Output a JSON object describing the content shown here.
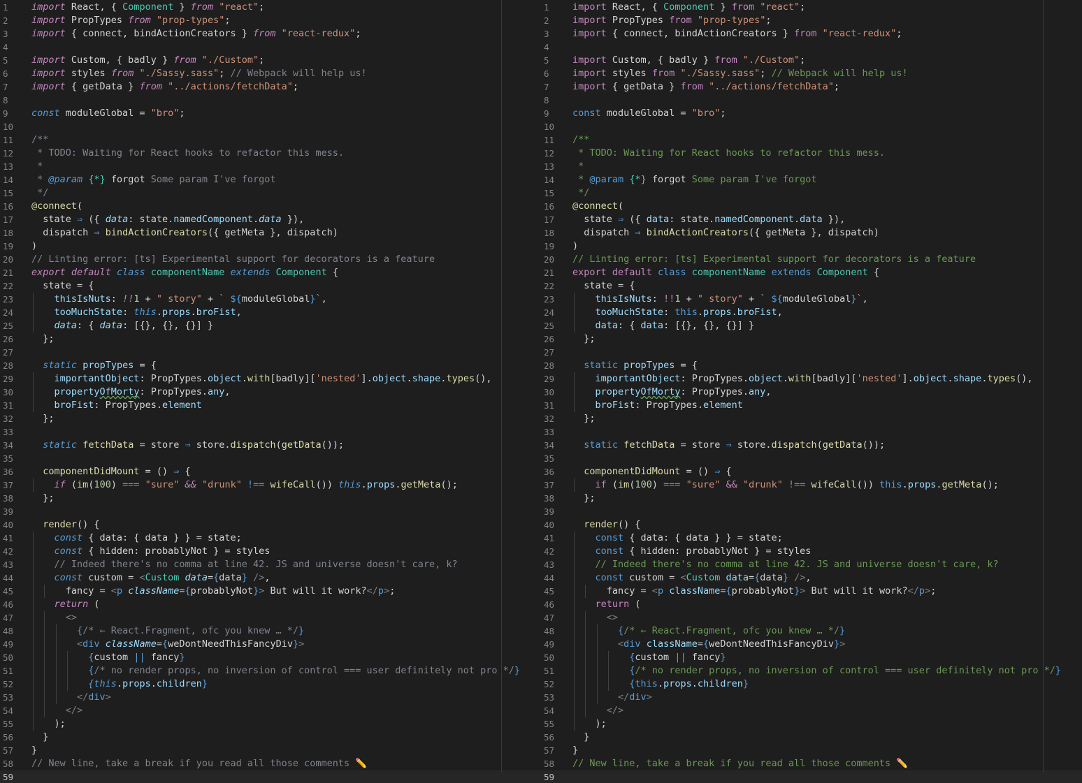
{
  "colors": {
    "background": "#1e1e1e",
    "line_number": "#858585",
    "keyword": "#c586c0",
    "storage": "#569cd6",
    "string": "#ce9178",
    "comment": "#6a9955",
    "comment_left": "#7f848e",
    "property": "#9cdcfe",
    "function": "#dcdcaa",
    "class": "#4ec9b0",
    "number": "#b5cea8",
    "plain": "#d4d4d4"
  },
  "editor": {
    "cursor_line": 59,
    "panes": [
      {
        "name": "left",
        "italic_keywords": true,
        "comment_color": "#7f848e"
      },
      {
        "name": "right",
        "italic_keywords": false,
        "comment_color": "#6a9955"
      }
    ]
  },
  "code_lines": [
    [
      [
        "k",
        "import"
      ],
      [
        "p",
        " React, { "
      ],
      [
        "t",
        "Component"
      ],
      [
        "p",
        " } "
      ],
      [
        "k",
        "from"
      ],
      [
        "s",
        " \"react\""
      ],
      [
        "p",
        ";"
      ]
    ],
    [
      [
        "k",
        "import"
      ],
      [
        "p",
        " PropTypes "
      ],
      [
        "k",
        "from"
      ],
      [
        "s",
        " \"prop-types\""
      ],
      [
        "p",
        ";"
      ]
    ],
    [
      [
        "k",
        "import"
      ],
      [
        "p",
        " { connect, bindActionCreators } "
      ],
      [
        "k",
        "from"
      ],
      [
        "s",
        " \"react-redux\""
      ],
      [
        "p",
        ";"
      ]
    ],
    [],
    [
      [
        "k",
        "import"
      ],
      [
        "p",
        " Custom, { badly } "
      ],
      [
        "k",
        "from"
      ],
      [
        "s",
        " \"./Custom\""
      ],
      [
        "p",
        ";"
      ]
    ],
    [
      [
        "k",
        "import"
      ],
      [
        "p",
        " styles "
      ],
      [
        "k",
        "from"
      ],
      [
        "s",
        " \"./Sassy.sass\""
      ],
      [
        "p",
        "; "
      ],
      [
        "c",
        "// Webpack will help us!"
      ]
    ],
    [
      [
        "k",
        "import"
      ],
      [
        "p",
        " { getData } "
      ],
      [
        "k",
        "from"
      ],
      [
        "s",
        " \"../actions/fetchData\""
      ],
      [
        "p",
        ";"
      ]
    ],
    [],
    [
      [
        "b",
        "const"
      ],
      [
        "p",
        " moduleGlobal = "
      ],
      [
        "s",
        "\"bro\""
      ],
      [
        "p",
        ";"
      ]
    ],
    [],
    [
      [
        "c",
        "/**"
      ]
    ],
    [
      [
        "c",
        " * TODO: Waiting for React hooks to refactor this mess."
      ]
    ],
    [
      [
        "c",
        " *"
      ]
    ],
    [
      [
        "c",
        " * "
      ],
      [
        "b",
        "@param"
      ],
      [
        "p",
        " "
      ],
      [
        "t",
        "{*}"
      ],
      [
        "p",
        " forgot"
      ],
      [
        "c",
        " Some param I've forgot"
      ]
    ],
    [
      [
        "c",
        " */"
      ]
    ],
    [
      [
        "f",
        "@connect"
      ],
      [
        "p",
        "("
      ]
    ],
    [
      [
        "p",
        "  state "
      ],
      [
        "b",
        "⇒"
      ],
      [
        "p",
        " ({ "
      ],
      [
        "v",
        "data"
      ],
      [
        "p",
        ": state."
      ],
      [
        "v",
        "namedComponent"
      ],
      [
        "p",
        "."
      ],
      [
        "v",
        "data"
      ],
      [
        "p",
        " }),"
      ]
    ],
    [
      [
        "p",
        "  dispatch "
      ],
      [
        "b",
        "⇒"
      ],
      [
        "p",
        " "
      ],
      [
        "f",
        "bindActionCreators"
      ],
      [
        "p",
        "({ getMeta }, dispatch)"
      ]
    ],
    [
      [
        "p",
        ")"
      ]
    ],
    [
      [
        "c",
        "// Linting error: [ts] Experimental support for decorators is a feature"
      ]
    ],
    [
      [
        "k",
        "export"
      ],
      [
        "p",
        " "
      ],
      [
        "k",
        "default"
      ],
      [
        "p",
        " "
      ],
      [
        "b",
        "class"
      ],
      [
        "p",
        " "
      ],
      [
        "t",
        "componentName"
      ],
      [
        "p",
        " "
      ],
      [
        "b",
        "extends"
      ],
      [
        "p",
        " "
      ],
      [
        "t",
        "Component"
      ],
      [
        "p",
        " {"
      ]
    ],
    [
      [
        "p",
        "  state = {"
      ]
    ],
    [
      [
        "p",
        "    "
      ],
      [
        "v",
        "thisIsNuts"
      ],
      [
        "p",
        ": "
      ],
      [
        "k",
        "!!"
      ],
      [
        "n",
        "1"
      ],
      [
        "p",
        " + "
      ],
      [
        "s",
        "\" story\""
      ],
      [
        "p",
        " + "
      ],
      [
        "s",
        "` "
      ],
      [
        "b",
        "${"
      ],
      [
        "p",
        "moduleGlobal"
      ],
      [
        "b",
        "}"
      ],
      [
        "s",
        "`"
      ],
      [
        "p",
        ","
      ]
    ],
    [
      [
        "p",
        "    "
      ],
      [
        "v",
        "tooMuchState"
      ],
      [
        "p",
        ": "
      ],
      [
        "b",
        "this"
      ],
      [
        "p",
        "."
      ],
      [
        "v",
        "props"
      ],
      [
        "p",
        "."
      ],
      [
        "v",
        "broFist"
      ],
      [
        "p",
        ","
      ]
    ],
    [
      [
        "p",
        "    "
      ],
      [
        "v",
        "data"
      ],
      [
        "p",
        ": { "
      ],
      [
        "v",
        "data"
      ],
      [
        "p",
        ": [{}, {}, {}] }"
      ]
    ],
    [
      [
        "p",
        "  };"
      ]
    ],
    [],
    [
      [
        "p",
        "  "
      ],
      [
        "b",
        "static"
      ],
      [
        "p",
        " "
      ],
      [
        "v",
        "propTypes"
      ],
      [
        "p",
        " = {"
      ]
    ],
    [
      [
        "p",
        "    "
      ],
      [
        "v",
        "importantObject"
      ],
      [
        "p",
        ": PropTypes."
      ],
      [
        "v",
        "object"
      ],
      [
        "p",
        "."
      ],
      [
        "f",
        "with"
      ],
      [
        "p",
        "[badly]["
      ],
      [
        "s",
        "'nested'"
      ],
      [
        "p",
        "]."
      ],
      [
        "v",
        "object"
      ],
      [
        "p",
        "."
      ],
      [
        "v",
        "shape"
      ],
      [
        "p",
        "."
      ],
      [
        "f",
        "types"
      ],
      [
        "p",
        "(),"
      ]
    ],
    [
      [
        "p",
        "    "
      ],
      [
        "v",
        "property"
      ],
      [
        "w",
        "OfMorty"
      ],
      [
        "p",
        ": PropTypes."
      ],
      [
        "v",
        "any"
      ],
      [
        "p",
        ","
      ]
    ],
    [
      [
        "p",
        "    "
      ],
      [
        "v",
        "broFist"
      ],
      [
        "p",
        ": PropTypes."
      ],
      [
        "v",
        "element"
      ]
    ],
    [
      [
        "p",
        "  };"
      ]
    ],
    [],
    [
      [
        "p",
        "  "
      ],
      [
        "b",
        "static"
      ],
      [
        "p",
        " "
      ],
      [
        "f",
        "fetchData"
      ],
      [
        "p",
        " = store "
      ],
      [
        "b",
        "⇒"
      ],
      [
        "p",
        " store."
      ],
      [
        "f",
        "dispatch"
      ],
      [
        "p",
        "("
      ],
      [
        "f",
        "getData"
      ],
      [
        "p",
        "());"
      ]
    ],
    [],
    [
      [
        "p",
        "  "
      ],
      [
        "f",
        "componentDidMount"
      ],
      [
        "p",
        " = () "
      ],
      [
        "b",
        "⇒"
      ],
      [
        "p",
        " {"
      ]
    ],
    [
      [
        "p",
        "    "
      ],
      [
        "k",
        "if"
      ],
      [
        "p",
        " ("
      ],
      [
        "f",
        "im"
      ],
      [
        "p",
        "("
      ],
      [
        "n",
        "100"
      ],
      [
        "p",
        ") "
      ],
      [
        "b",
        "==="
      ],
      [
        "p",
        " "
      ],
      [
        "s",
        "\"sure\""
      ],
      [
        "p",
        " "
      ],
      [
        "k",
        "&&"
      ],
      [
        "p",
        " "
      ],
      [
        "s",
        "\"drunk\""
      ],
      [
        "p",
        " "
      ],
      [
        "b",
        "!=="
      ],
      [
        "p",
        " "
      ],
      [
        "f",
        "wifeCall"
      ],
      [
        "p",
        "()) "
      ],
      [
        "b",
        "this"
      ],
      [
        "p",
        "."
      ],
      [
        "v",
        "props"
      ],
      [
        "p",
        "."
      ],
      [
        "f",
        "getMeta"
      ],
      [
        "p",
        "();"
      ]
    ],
    [
      [
        "p",
        "  };"
      ]
    ],
    [],
    [
      [
        "p",
        "  "
      ],
      [
        "f",
        "render"
      ],
      [
        "p",
        "() {"
      ]
    ],
    [
      [
        "p",
        "    "
      ],
      [
        "b",
        "const"
      ],
      [
        "p",
        " { data: { data } } = state;"
      ]
    ],
    [
      [
        "p",
        "    "
      ],
      [
        "b",
        "const"
      ],
      [
        "p",
        " { hidden: probablyNot } = styles"
      ]
    ],
    [
      [
        "p",
        "    "
      ],
      [
        "c",
        "// Indeed there's no comma at line 42. JS and universe doesn't care, k?"
      ]
    ],
    [
      [
        "p",
        "    "
      ],
      [
        "b",
        "const"
      ],
      [
        "p",
        " custom = "
      ],
      [
        "g",
        "<"
      ],
      [
        "t",
        "Custom"
      ],
      [
        "p",
        " "
      ],
      [
        "v",
        "data"
      ],
      [
        "p",
        "="
      ],
      [
        "b",
        "{"
      ],
      [
        "p",
        "data"
      ],
      [
        "b",
        "}"
      ],
      [
        "p",
        " "
      ],
      [
        "g",
        "/>"
      ],
      [
        "p",
        ","
      ]
    ],
    [
      [
        "p",
        "      fancy = "
      ],
      [
        "g",
        "<"
      ],
      [
        "b",
        "p"
      ],
      [
        "p",
        " "
      ],
      [
        "v",
        "className"
      ],
      [
        "p",
        "="
      ],
      [
        "b",
        "{"
      ],
      [
        "p",
        "probablyNot"
      ],
      [
        "b",
        "}"
      ],
      [
        "g",
        ">"
      ],
      [
        "p",
        " But will it work?"
      ],
      [
        "g",
        "</"
      ],
      [
        "b",
        "p"
      ],
      [
        "g",
        ">"
      ],
      [
        "p",
        ";"
      ]
    ],
    [
      [
        "p",
        "    "
      ],
      [
        "k",
        "return"
      ],
      [
        "p",
        " ("
      ]
    ],
    [
      [
        "p",
        "      "
      ],
      [
        "g",
        "<>"
      ]
    ],
    [
      [
        "p",
        "        "
      ],
      [
        "b",
        "{"
      ],
      [
        "c",
        "/* ← React.Fragment, ofc you knew … */"
      ],
      [
        "b",
        "}"
      ]
    ],
    [
      [
        "p",
        "        "
      ],
      [
        "g",
        "<"
      ],
      [
        "b",
        "div"
      ],
      [
        "p",
        " "
      ],
      [
        "v",
        "className"
      ],
      [
        "p",
        "="
      ],
      [
        "b",
        "{"
      ],
      [
        "p",
        "weDontNeedThisFancyDiv"
      ],
      [
        "b",
        "}"
      ],
      [
        "g",
        ">"
      ]
    ],
    [
      [
        "p",
        "          "
      ],
      [
        "b",
        "{"
      ],
      [
        "p",
        "custom "
      ],
      [
        "b",
        "||"
      ],
      [
        "p",
        " fancy"
      ],
      [
        "b",
        "}"
      ]
    ],
    [
      [
        "p",
        "          "
      ],
      [
        "b",
        "{"
      ],
      [
        "c",
        "/* no render props, no inversion of control === user definitely not pro */"
      ],
      [
        "b",
        "}"
      ]
    ],
    [
      [
        "p",
        "          "
      ],
      [
        "b",
        "{this"
      ],
      [
        "p",
        "."
      ],
      [
        "v",
        "props"
      ],
      [
        "p",
        "."
      ],
      [
        "v",
        "children"
      ],
      [
        "b",
        "}"
      ]
    ],
    [
      [
        "p",
        "        "
      ],
      [
        "g",
        "</"
      ],
      [
        "b",
        "div"
      ],
      [
        "g",
        ">"
      ]
    ],
    [
      [
        "p",
        "      "
      ],
      [
        "g",
        "</>"
      ]
    ],
    [
      [
        "p",
        "    );"
      ]
    ],
    [
      [
        "p",
        "  }"
      ]
    ],
    [
      [
        "p",
        "}"
      ]
    ],
    [
      [
        "c",
        "// New line, take a break if you read all those comments "
      ],
      [
        "e",
        "✏️"
      ]
    ],
    []
  ]
}
